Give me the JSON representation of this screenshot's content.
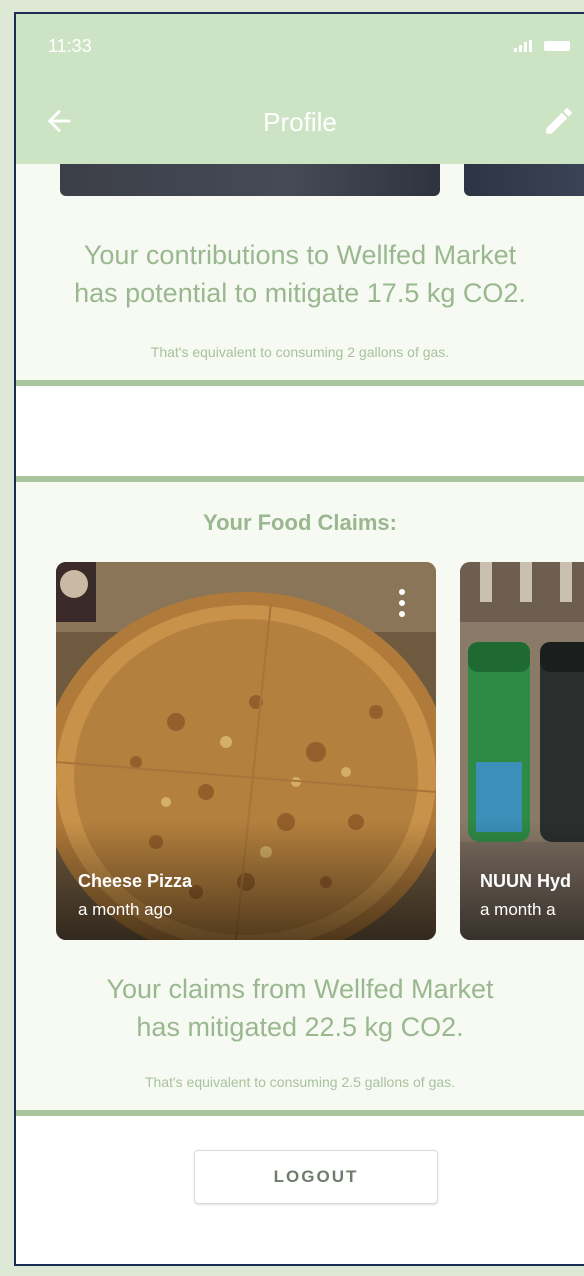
{
  "status_bar": {
    "time": "11:33"
  },
  "app_bar": {
    "title": "Profile"
  },
  "contributions": {
    "headline": "Your contributions to Wellfed Market has potential to mitigate 17.5 kg CO2.",
    "headline_line1": "Your contributions to Wellfed Market",
    "headline_line2": "has potential to mitigate 17.5 kg CO2.",
    "equivalent": "That's equivalent to consuming 2 gallons of gas."
  },
  "claims": {
    "heading": "Your Food Claims:",
    "items": [
      {
        "title": "Cheese Pizza",
        "time": "a month ago",
        "image": "pizza-photo"
      },
      {
        "title": "NUUN Hyd",
        "time": "a month a",
        "image": "nuun-tubes-photo"
      }
    ],
    "summary_line1": "Your claims from Wellfed Market",
    "summary_line2": "has mitigated 22.5 kg CO2.",
    "equivalent": "That's equivalent to consuming 2.5 gallons of gas."
  },
  "logout_label": "LOGOUT",
  "colors": {
    "app_bar": "#cde4c4",
    "accent_green": "#9ab88f",
    "divider": "#a9c59e",
    "frame": "#1b2d57"
  },
  "icons": {
    "back": "arrow-left-icon",
    "edit": "pencil-icon",
    "more": "more-vertical-icon"
  }
}
